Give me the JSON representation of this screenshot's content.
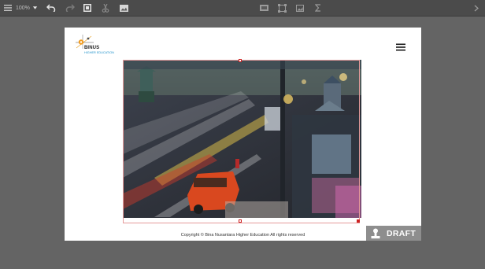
{
  "toolbar": {
    "zoom": "100%",
    "items": [
      {
        "name": "menu-icon",
        "enabled": true
      },
      {
        "name": "zoom-select",
        "enabled": true
      },
      {
        "name": "undo-icon",
        "enabled": true
      },
      {
        "name": "redo-icon",
        "enabled": false
      },
      {
        "name": "fit-frame-icon",
        "enabled": true
      },
      {
        "name": "cut-icon",
        "enabled": false
      },
      {
        "name": "image-frame-icon",
        "enabled": true
      },
      {
        "name": "barcode-icon",
        "enabled": false
      },
      {
        "name": "crop-frame-icon",
        "enabled": false
      },
      {
        "name": "picture-icon",
        "enabled": false
      },
      {
        "name": "sigma-icon",
        "enabled": false
      },
      {
        "name": "chevron-right-icon",
        "enabled": false
      }
    ]
  },
  "page": {
    "logo": {
      "name": "BINUS",
      "subtitle": "HIGHER EDUCATION"
    },
    "menu_icon": "hamburger-icon",
    "photo": {
      "subject": "night street traffic long exposure"
    },
    "footer": "Copyright © Bina Nusantara Higher Education All rights reserved"
  },
  "badge": {
    "label": "DRAFT",
    "icon": "stamp-icon"
  },
  "colors": {
    "workspace": "#646464",
    "toolbar": "#4b4b4b",
    "selection_handle": "#cc2222",
    "logo_accent": "#f29c1f",
    "logo_sub": "#1a8fc9",
    "draft_badge": "#8e8e8e"
  }
}
